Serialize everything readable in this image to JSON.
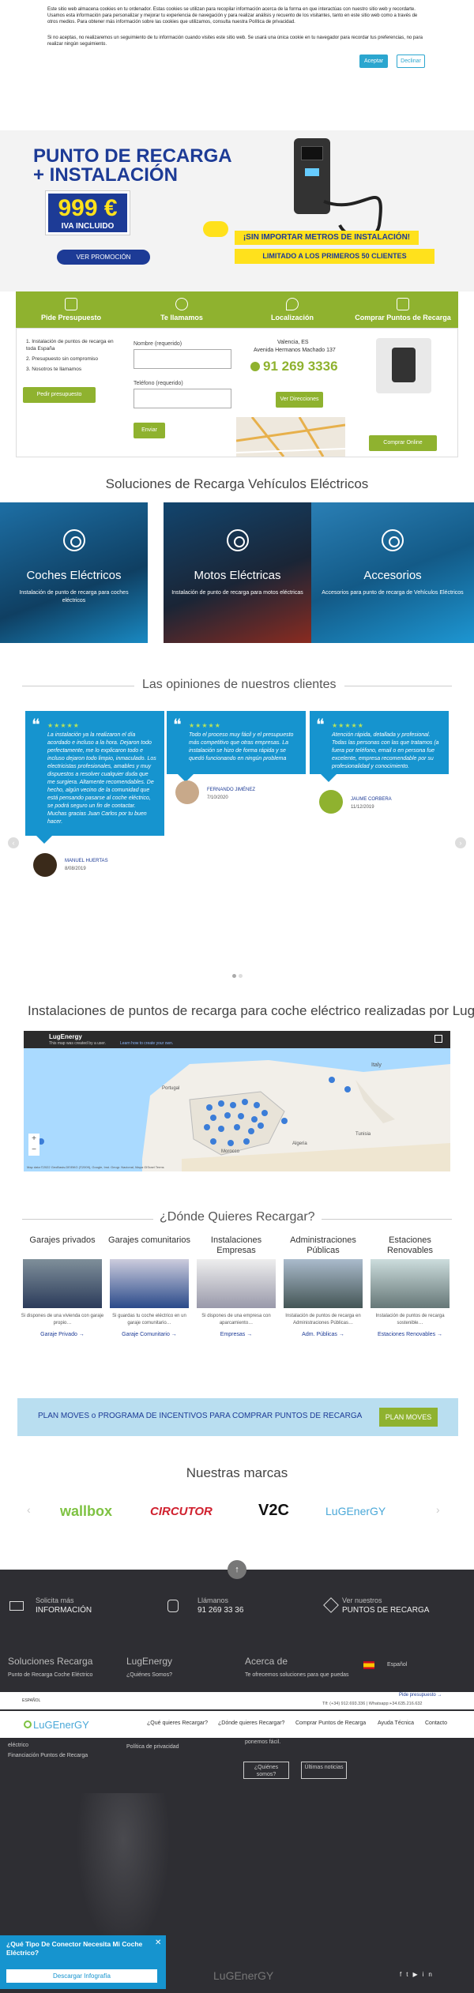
{
  "cookie": {
    "text1": "Este sitio web almacena cookies en tu ordenador. Estas cookies se utilizan para recopilar información acerca de la forma en que interactúas con nuestro sitio web y recordarte. Usamos esta información para personalizar y mejorar tu experiencia de navegación y para realizar análisis y recuento de los visitantes, tanto en este sitio web como a través de otros medios. Para obtener más información sobre las cookies que utilizamos, consulta nuestra Política de privacidad.",
    "text2": "Si no aceptas, no realizaremos un seguimiento de tu información cuando visites este sitio web. Se usará una única cookie en tu navegador para recordar tus preferencias, no para realizar ningún seguimiento.",
    "accept": "Aceptar",
    "decline": "Declinar"
  },
  "hero": {
    "line1": "PUNTO DE RECARGA",
    "line2": "+ INSTALACIÓN",
    "price": "999 €",
    "iva": "IVA INCLUIDO",
    "promo_button": "VER PROMOCIÓN",
    "banner1": "¡SIN IMPORTAR METROS DE INSTALACIÓN!",
    "banner2": "LIMITADO A LOS PRIMEROS 50 CLIENTES"
  },
  "tabs": [
    "Pide Presupuesto",
    "Te llamamos",
    "Localización",
    "Comprar Puntos de Recarga"
  ],
  "panel1": {
    "items": [
      "1. Instalación de puntos de recarga en toda España",
      "2. Presupuesto sin compromiso",
      "3. Nosotros te llamamos"
    ],
    "button": "Pedir presupuesto"
  },
  "panel2": {
    "name_label": "Nombre (requerido)",
    "phone_label": "Teléfono (requerido)",
    "button": "Enviar"
  },
  "panel3": {
    "address1": "Valencia, ES",
    "address2": "Avenida Hermanos Machado 137",
    "phone": "91 269 3336",
    "button": "Ver Direcciones"
  },
  "panel4": {
    "button": "Comprar Online"
  },
  "solutions": {
    "title": "Soluciones de Recarga Vehículos Eléctricos",
    "items": [
      {
        "title": "Coches Eléctricos",
        "desc": "Instalación de punto de recarga para coches eléctricos"
      },
      {
        "title": "Motos Eléctricas",
        "desc": "Instalación de punto de recarga para motos eléctricas"
      },
      {
        "title": "Accesorios",
        "desc": "Accesorios para punto de recarga de Vehículos Eléctricos"
      }
    ]
  },
  "reviews": {
    "title": "Las opiniones de nuestros clientes",
    "stars": "★★★★★",
    "items": [
      {
        "text": "La instalación ya la realizaron el día acordado e incluso a la hora. Dejaron todo perfectamente, me lo explicaron todo e incluso dejaron todo limpio, inmaculado. Los electricistas profesionales, amables y muy dispuestos a resolver cualquier duda que me surgiera. Altamente recomendables. De hecho, algún vecino de la comunidad que está pensando pasarse al coche eléctrico, se podrá seguro un fin de contactar. Muchas gracias Juan Carlos por tu buen hacer.",
        "name": "MANUEL HUERTAS",
        "date": "8/08/2019"
      },
      {
        "text": "Todo el proceso muy fácil y el presupuesto más competitivo que otras empresas. La instalación se hizo de forma rápida y se quedó funcionando en ningún problema",
        "name": "FERNANDO JIMÉNEZ",
        "date": "7/10/2020"
      },
      {
        "text": "Atención rápida, detallada y profesional. Todas las personas con las que tratamos (a fuera por teléfono, email o en persona fue excelente, empresa recomendable por su profesionalidad y conocimiento.",
        "name": "JAUME CORBERA",
        "date": "11/12/2019"
      }
    ]
  },
  "map": {
    "title": "Instalaciones de puntos de recarga para coche eléctrico realizadas por LugEnergy",
    "brand": "LugEnergy",
    "notice": "This map was created by a user.",
    "learn": "Learn how to create your own.",
    "countries": [
      "Portugal",
      "Italy",
      "Algeria",
      "Tunisia",
      "Morocco"
    ],
    "footer_text": "Map data ©2022 GeoBasis-DE/BKG (©2009), Google, Inst. Geogr. Nacional, Mapa GISrael  Terms"
  },
  "where": {
    "title": "¿Dónde Quieres Recargar?",
    "items": [
      {
        "title": "Garajes privados",
        "desc": "Si dispones de una vivienda con garaje propio…",
        "link": "Garaje Privado →"
      },
      {
        "title": "Garajes comunitarios",
        "desc": "Si guardas tu coche eléctrico en un garaje comunitario…",
        "link": "Garaje Comunitario →"
      },
      {
        "title": "Instalaciones Empresas",
        "desc": "Si dispones de una empresa con aparcamiento…",
        "link": "Empresas →"
      },
      {
        "title": "Administraciones Públicas",
        "desc": "Instalación de puntos de recarga en Administraciones Públicas…",
        "link": "Adm. Públicas →"
      },
      {
        "title": "Estaciones Renovables",
        "desc": "Instalación de puntos de recarga sostenible…",
        "link": "Estaciones Renovables →"
      }
    ]
  },
  "moves": {
    "text": "PLAN MOVES o PROGRAMA DE INCENTIVOS PARA COMPRAR PUNTOS DE RECARGA",
    "button": "PLAN MOVES"
  },
  "brands": {
    "title": "Nuestras marcas",
    "items": [
      "wallbox",
      "CIRCUTOR",
      "V2C",
      "LuGEnerGY"
    ]
  },
  "footer": {
    "cta": [
      {
        "line1": "Solicita más",
        "line2": "INFORMACIÓN"
      },
      {
        "line1": "Llámanos",
        "line2": "91 269 33 36"
      },
      {
        "line1": "Ver nuestros",
        "line2": "PUNTOS DE RECARGA"
      }
    ],
    "col1_title": "Soluciones Recarga",
    "col1_links": [
      "Punto de Recarga Coche Eléctrico",
      "eléctrico",
      "Financiación Puntos de Recarga"
    ],
    "col2_title": "LugEnergy",
    "col2_links": [
      "¿Quiénes Somos?",
      "Política de privacidad"
    ],
    "col3_title": "Acerca de",
    "col3_text1": "Te ofrecemos soluciones para que puedas",
    "col3_text2": "ponemos fácil.",
    "about_btn": "¿Quiénes somos?",
    "news_btn": "Últimas noticias",
    "language": "Español",
    "bottom_logo": "LuGEnerGY",
    "social": [
      "f",
      "t",
      "▶",
      "in"
    ]
  },
  "sticky": {
    "lang": "ESPAÑOL",
    "quote": "Pide presupuesto →",
    "phone_line": "Tlf: (+34) 912.693.336  |  Whatsapp:+34.635.216.632",
    "logo": "LuGEnerGY",
    "nav": [
      "¿Qué quieres Recargar?",
      "¿Dónde quieres Recargar?",
      "Comprar Puntos de Recarga",
      "Ayuda Técnica",
      "Contacto"
    ]
  },
  "popup": {
    "title": "¿Qué Tipo De Conector Necesita Mi Coche Eléctrico?",
    "button": "Descargar Infografía"
  },
  "colors": {
    "blue": "#1d3b96",
    "green": "#8fb22f",
    "cyan": "#1694cf",
    "yellow": "#ffe11c",
    "dark": "#2e2e33"
  }
}
